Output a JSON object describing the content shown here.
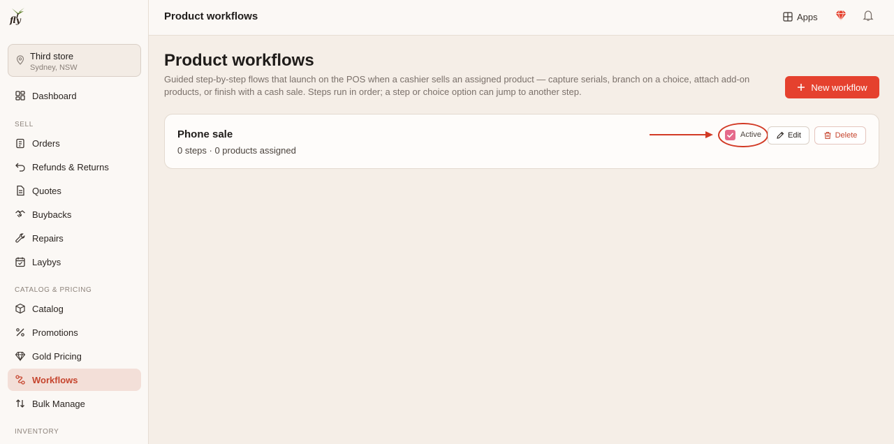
{
  "brand": {
    "logo_text": "fly"
  },
  "store": {
    "name": "Third store",
    "location": "Sydney, NSW"
  },
  "sidebar": {
    "dashboard": "Dashboard",
    "sections": {
      "sell": "SELL",
      "catalog_pricing": "CATALOG & PRICING",
      "inventory": "INVENTORY"
    },
    "sell_items": [
      "Orders",
      "Refunds & Returns",
      "Quotes",
      "Buybacks",
      "Repairs",
      "Laybys"
    ],
    "catalog_items": [
      "Catalog",
      "Promotions",
      "Gold Pricing",
      "Workflows",
      "Bulk Manage"
    ],
    "active_item": "Workflows"
  },
  "header": {
    "title": "Product workflows",
    "apps_label": "Apps"
  },
  "main": {
    "title": "Product workflows",
    "description": "Guided step-by-step flows that launch on the POS when a cashier sells an assigned product — capture serials, branch on a choice, attach add-on products, or finish with a cash sale. Steps run in order; a step or choice option can jump to another step.",
    "new_button": "New workflow"
  },
  "workflows": [
    {
      "name": "Phone sale",
      "meta": "0 steps · 0 products assigned",
      "active_label": "Active",
      "active": true,
      "edit_label": "Edit",
      "delete_label": "Delete"
    }
  ],
  "colors": {
    "accent": "#e5412e",
    "active_nav_bg": "#f3dfd8",
    "checkbox": "#e56a8b",
    "annotation": "#d23a25"
  }
}
